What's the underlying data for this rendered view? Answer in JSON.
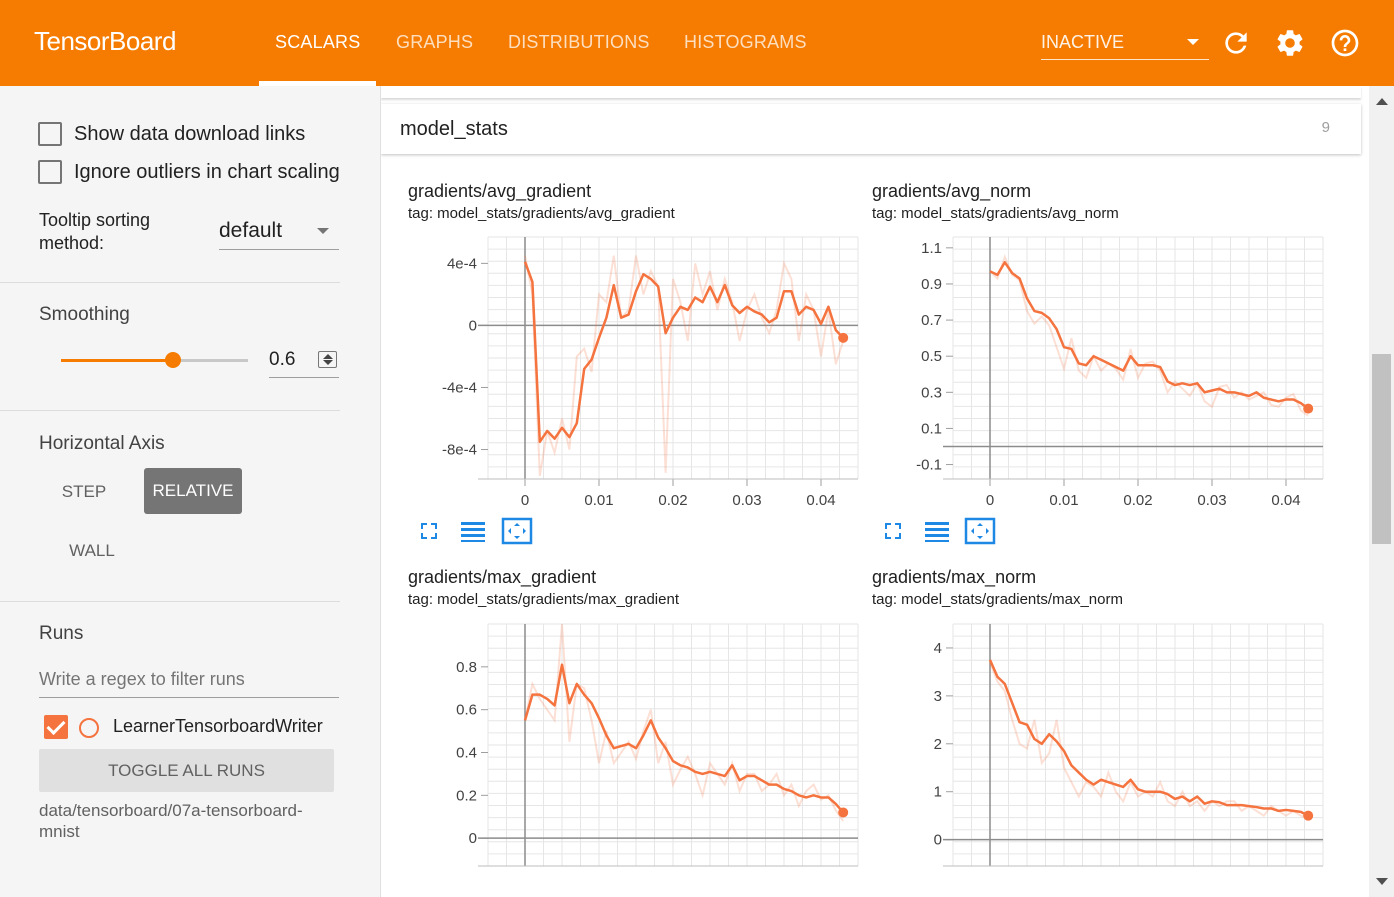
{
  "app": {
    "brand": "TensorBoard"
  },
  "nav": {
    "tabs": [
      {
        "label": "SCALARS",
        "active": true
      },
      {
        "label": "GRAPHS",
        "active": false
      },
      {
        "label": "DISTRIBUTIONS",
        "active": false
      },
      {
        "label": "HISTOGRAMS",
        "active": false
      }
    ],
    "plugin_select": "INACTIVE",
    "icons": [
      "refresh-icon",
      "settings-icon",
      "help-icon"
    ]
  },
  "sidebar": {
    "show_download_links": {
      "label": "Show data download links",
      "checked": false
    },
    "ignore_outliers": {
      "label": "Ignore outliers in chart scaling",
      "checked": false
    },
    "tooltip_sorting": {
      "label": "Tooltip sorting method:",
      "value": "default"
    },
    "smoothing": {
      "label": "Smoothing",
      "value": "0.6",
      "fraction": 0.6
    },
    "horizontal_axis": {
      "label": "Horizontal Axis",
      "options": [
        "STEP",
        "RELATIVE",
        "WALL"
      ],
      "selected": "RELATIVE"
    },
    "runs": {
      "label": "Runs",
      "filter_placeholder": "Write a regex to filter runs",
      "items": [
        {
          "name": "LearnerTensorboardWriter",
          "checked": true,
          "color": "#f4733e"
        }
      ],
      "toggle_all": "TOGGLE ALL RUNS",
      "logdir": "data/tensorboard/07a-tensorboard-mnist"
    }
  },
  "main": {
    "category": {
      "name": "model_stats",
      "count": "9"
    },
    "accent_color": "#f4733e",
    "charts": [
      {
        "title": "gradients/avg_gradient",
        "tag": "tag: model_stats/gradients/avg_gradient",
        "chart_data": {
          "type": "line",
          "xlabel": "",
          "ylabel": "",
          "xlim": [
            -0.005,
            0.045
          ],
          "ylim": [
            -0.00099,
            0.00057
          ],
          "x_ticks": [
            {
              "v": 0,
              "t": "0"
            },
            {
              "v": 0.01,
              "t": "0.01"
            },
            {
              "v": 0.02,
              "t": "0.02"
            },
            {
              "v": 0.03,
              "t": "0.03"
            },
            {
              "v": 0.04,
              "t": "0.04"
            }
          ],
          "y_ticks": [
            {
              "v": 0.0004,
              "t": "4e-4"
            },
            {
              "v": 0,
              "t": "0"
            },
            {
              "v": -0.0004,
              "t": "-4e-4"
            },
            {
              "v": -0.0008,
              "t": "-8e-4"
            }
          ],
          "x": [
            0,
            0.001,
            0.002,
            0.003,
            0.004,
            0.005,
            0.006,
            0.007,
            0.008,
            0.009,
            0.01,
            0.011,
            0.012,
            0.013,
            0.014,
            0.015,
            0.016,
            0.017,
            0.018,
            0.019,
            0.02,
            0.021,
            0.022,
            0.023,
            0.024,
            0.025,
            0.026,
            0.027,
            0.028,
            0.029,
            0.03,
            0.031,
            0.032,
            0.033,
            0.034,
            0.035,
            0.036,
            0.037,
            0.038,
            0.039,
            0.04,
            0.041,
            0.042,
            0.043
          ],
          "raw": [
            0.00045,
            0.0002,
            -0.00097,
            -0.00068,
            -0.00082,
            -0.0006,
            -0.0008,
            -0.0002,
            -0.00015,
            -0.0003,
            0.0002,
            0.00015,
            0.00045,
            5e-05,
            0.0001,
            0.00045,
            0.0002,
            0.00035,
            0.00025,
            -0.00095,
            0.0003,
            0.00015,
            -0.0001,
            0.0004,
            0.0002,
            0.00035,
            0.0001,
            0.0003,
            0.00015,
            -0.0001,
            0.0001,
            0.0002,
            5e-05,
            -5e-05,
            0.0001,
            0.0004,
            0.0003,
            -0.0001,
            0.0002,
            0.0001,
            -0.0002,
            0.0001,
            -0.00025,
            -0.0001
          ],
          "smoothed": [
            0.00041,
            0.00028,
            -0.00075,
            -0.00068,
            -0.00073,
            -0.00066,
            -0.00072,
            -0.00063,
            -0.00028,
            -0.00022,
            -8e-05,
            5e-05,
            0.00026,
            5e-05,
            7e-05,
            0.00022,
            0.00033,
            0.0003,
            0.00025,
            -5e-05,
            5e-05,
            0.00012,
            0.0001,
            0.00018,
            0.00015,
            0.00025,
            0.00015,
            0.00026,
            0.00013,
            8e-05,
            0.00012,
            9e-05,
            7e-05,
            2e-05,
            5e-05,
            0.00022,
            0.00022,
            7e-05,
            0.00012,
            0.0001,
            1e-05,
            0.00012,
            -3e-05,
            -8e-05
          ]
        }
      },
      {
        "title": "gradients/avg_norm",
        "tag": "tag: model_stats/gradients/avg_norm",
        "chart_data": {
          "type": "line",
          "xlabel": "",
          "ylabel": "",
          "xlim": [
            -0.005,
            0.045
          ],
          "ylim": [
            -0.18,
            1.16
          ],
          "x_ticks": [
            {
              "v": 0,
              "t": "0"
            },
            {
              "v": 0.01,
              "t": "0.01"
            },
            {
              "v": 0.02,
              "t": "0.02"
            },
            {
              "v": 0.03,
              "t": "0.03"
            },
            {
              "v": 0.04,
              "t": "0.04"
            }
          ],
          "y_ticks": [
            {
              "v": 1.1,
              "t": "1.1"
            },
            {
              "v": 0.9,
              "t": "0.9"
            },
            {
              "v": 0.7,
              "t": "0.7"
            },
            {
              "v": 0.5,
              "t": "0.5"
            },
            {
              "v": 0.3,
              "t": "0.3"
            },
            {
              "v": 0.1,
              "t": "0.1"
            },
            {
              "v": -0.1,
              "t": "-0.1"
            }
          ],
          "x": [
            0,
            0.001,
            0.002,
            0.003,
            0.004,
            0.005,
            0.006,
            0.007,
            0.008,
            0.009,
            0.01,
            0.011,
            0.012,
            0.013,
            0.014,
            0.015,
            0.016,
            0.017,
            0.018,
            0.019,
            0.02,
            0.021,
            0.022,
            0.023,
            0.024,
            0.025,
            0.026,
            0.027,
            0.028,
            0.029,
            0.03,
            0.031,
            0.032,
            0.033,
            0.034,
            0.035,
            0.036,
            0.037,
            0.038,
            0.039,
            0.04,
            0.041,
            0.042,
            0.043
          ],
          "raw": [
            0.97,
            0.93,
            1.05,
            0.95,
            0.92,
            0.75,
            0.68,
            0.72,
            0.67,
            0.55,
            0.43,
            0.6,
            0.42,
            0.38,
            0.5,
            0.42,
            0.46,
            0.43,
            0.37,
            0.54,
            0.38,
            0.46,
            0.47,
            0.42,
            0.3,
            0.36,
            0.32,
            0.28,
            0.35,
            0.25,
            0.22,
            0.33,
            0.34,
            0.27,
            0.3,
            0.26,
            0.28,
            0.3,
            0.23,
            0.22,
            0.27,
            0.29,
            0.2,
            0.17
          ],
          "smoothed": [
            0.97,
            0.95,
            1.02,
            0.96,
            0.93,
            0.82,
            0.75,
            0.74,
            0.71,
            0.65,
            0.55,
            0.54,
            0.46,
            0.45,
            0.5,
            0.48,
            0.46,
            0.44,
            0.42,
            0.5,
            0.45,
            0.45,
            0.45,
            0.44,
            0.36,
            0.34,
            0.35,
            0.34,
            0.35,
            0.3,
            0.31,
            0.32,
            0.3,
            0.3,
            0.29,
            0.28,
            0.3,
            0.27,
            0.26,
            0.25,
            0.26,
            0.26,
            0.24,
            0.21
          ]
        }
      },
      {
        "title": "gradients/max_gradient",
        "tag": "tag: model_stats/gradients/max_gradient",
        "chart_data": {
          "type": "line",
          "xlabel": "",
          "ylabel": "",
          "xlim": [
            -0.005,
            0.045
          ],
          "ylim": [
            -0.13,
            1.0
          ],
          "x_ticks": [],
          "y_ticks": [
            {
              "v": 0.8,
              "t": "0.8"
            },
            {
              "v": 0.6,
              "t": "0.6"
            },
            {
              "v": 0.4,
              "t": "0.4"
            },
            {
              "v": 0.2,
              "t": "0.2"
            },
            {
              "v": 0,
              "t": "0"
            }
          ],
          "x": [
            0,
            0.001,
            0.002,
            0.003,
            0.004,
            0.005,
            0.006,
            0.007,
            0.008,
            0.009,
            0.01,
            0.011,
            0.012,
            0.013,
            0.014,
            0.015,
            0.016,
            0.017,
            0.018,
            0.019,
            0.02,
            0.021,
            0.022,
            0.023,
            0.024,
            0.025,
            0.026,
            0.027,
            0.028,
            0.029,
            0.03,
            0.031,
            0.032,
            0.033,
            0.034,
            0.035,
            0.036,
            0.037,
            0.038,
            0.039,
            0.04,
            0.041,
            0.042,
            0.043
          ],
          "raw": [
            0.55,
            0.72,
            0.65,
            0.6,
            0.55,
            1.0,
            0.45,
            0.72,
            0.7,
            0.55,
            0.35,
            0.5,
            0.35,
            0.4,
            0.45,
            0.37,
            0.5,
            0.6,
            0.35,
            0.45,
            0.25,
            0.32,
            0.38,
            0.3,
            0.2,
            0.35,
            0.3,
            0.25,
            0.35,
            0.22,
            0.3,
            0.3,
            0.22,
            0.25,
            0.3,
            0.2,
            0.25,
            0.15,
            0.22,
            0.25,
            0.18,
            0.2,
            0.13,
            0.08
          ],
          "smoothed": [
            0.55,
            0.67,
            0.67,
            0.65,
            0.62,
            0.81,
            0.63,
            0.72,
            0.67,
            0.63,
            0.56,
            0.48,
            0.42,
            0.43,
            0.44,
            0.42,
            0.48,
            0.55,
            0.47,
            0.42,
            0.36,
            0.34,
            0.33,
            0.31,
            0.3,
            0.31,
            0.3,
            0.29,
            0.34,
            0.27,
            0.29,
            0.29,
            0.27,
            0.25,
            0.25,
            0.23,
            0.22,
            0.2,
            0.19,
            0.2,
            0.19,
            0.19,
            0.16,
            0.12
          ]
        }
      },
      {
        "title": "gradients/max_norm",
        "tag": "tag: model_stats/gradients/max_norm",
        "chart_data": {
          "type": "line",
          "xlabel": "",
          "ylabel": "",
          "xlim": [
            -0.005,
            0.045
          ],
          "ylim": [
            -0.55,
            4.5
          ],
          "x_ticks": [],
          "y_ticks": [
            {
              "v": 4,
              "t": "4"
            },
            {
              "v": 3,
              "t": "3"
            },
            {
              "v": 2,
              "t": "2"
            },
            {
              "v": 1,
              "t": "1"
            },
            {
              "v": 0,
              "t": "0"
            }
          ],
          "x": [
            0,
            0.001,
            0.002,
            0.003,
            0.004,
            0.005,
            0.006,
            0.007,
            0.008,
            0.009,
            0.01,
            0.011,
            0.012,
            0.013,
            0.014,
            0.015,
            0.016,
            0.017,
            0.018,
            0.019,
            0.02,
            0.021,
            0.022,
            0.023,
            0.024,
            0.025,
            0.026,
            0.027,
            0.028,
            0.029,
            0.03,
            0.031,
            0.032,
            0.033,
            0.034,
            0.035,
            0.036,
            0.037,
            0.038,
            0.039,
            0.04,
            0.041,
            0.042,
            0.043
          ],
          "raw": [
            3.7,
            3.3,
            3.1,
            2.5,
            2.0,
            1.9,
            2.5,
            1.6,
            1.8,
            2.5,
            1.5,
            1.2,
            0.9,
            1.2,
            1.1,
            0.9,
            1.4,
            1.0,
            0.8,
            1.2,
            0.9,
            1.0,
            0.9,
            1.2,
            0.8,
            0.7,
            1.0,
            0.7,
            0.8,
            0.6,
            0.8,
            0.7,
            0.8,
            0.8,
            0.6,
            0.7,
            0.6,
            0.5,
            0.7,
            0.6,
            0.5,
            0.6,
            0.5,
            0.45
          ],
          "smoothed": [
            3.75,
            3.4,
            3.25,
            2.85,
            2.45,
            2.4,
            2.1,
            2.0,
            2.2,
            2.05,
            1.85,
            1.55,
            1.4,
            1.25,
            1.15,
            1.25,
            1.2,
            1.15,
            1.1,
            1.25,
            1.05,
            1.0,
            1.0,
            1.0,
            0.95,
            0.85,
            0.9,
            0.8,
            0.9,
            0.75,
            0.8,
            0.78,
            0.72,
            0.72,
            0.72,
            0.7,
            0.68,
            0.65,
            0.65,
            0.6,
            0.62,
            0.6,
            0.58,
            0.5
          ]
        }
      }
    ]
  }
}
